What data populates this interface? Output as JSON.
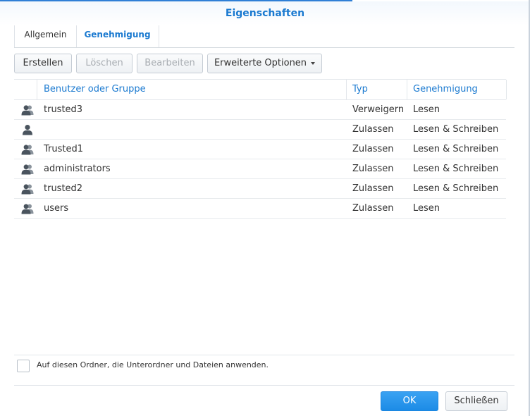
{
  "window": {
    "title": "Eigenschaften"
  },
  "tabs": [
    {
      "label": "Allgemein"
    },
    {
      "label": "Genehmigung"
    }
  ],
  "toolbar": {
    "create_label": "Erstellen",
    "delete_label": "Löschen",
    "edit_label": "Bearbeiten",
    "advanced_label": "Erweiterte Optionen"
  },
  "grid": {
    "columns": [
      "Benutzer oder Gruppe",
      "Typ",
      "Genehmigung"
    ],
    "rows": [
      {
        "icon": "group-icon",
        "name": "trusted3",
        "type": "Verweigern",
        "permission": "Lesen"
      },
      {
        "icon": "user-icon",
        "name": "",
        "type": "Zulassen",
        "permission": "Lesen & Schreiben"
      },
      {
        "icon": "group-icon",
        "name": "Trusted1",
        "type": "Zulassen",
        "permission": "Lesen & Schreiben"
      },
      {
        "icon": "group-icon",
        "name": "administrators",
        "type": "Zulassen",
        "permission": "Lesen & Schreiben"
      },
      {
        "icon": "group-icon",
        "name": "trusted2",
        "type": "Zulassen",
        "permission": "Lesen & Schreiben"
      },
      {
        "icon": "group-icon",
        "name": "users",
        "type": "Zulassen",
        "permission": "Lesen"
      }
    ]
  },
  "apply_option": {
    "label": "Auf diesen Ordner, die Unterordner und Dateien anwenden.",
    "checked": false
  },
  "footer": {
    "ok_label": "OK",
    "close_label": "Schließen"
  },
  "colors": {
    "accent": "#1b7ad0",
    "ok_button": "#1c8be6"
  }
}
